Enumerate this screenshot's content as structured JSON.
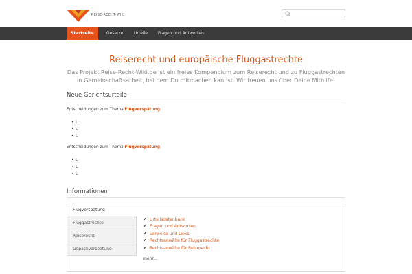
{
  "header": {
    "logo_text": "REISE-RECHT-WIKI",
    "brand_colors": [
      "#e5531c",
      "#c0392b",
      "#f0a020"
    ],
    "search": {
      "placeholder": "",
      "icon": "search-icon"
    }
  },
  "nav": {
    "items": [
      {
        "label": "Startseite",
        "active": true
      },
      {
        "label": "Gesetze",
        "active": false
      },
      {
        "label": "Urteile",
        "active": false
      },
      {
        "label": "Fragen und Antworten",
        "active": false
      }
    ]
  },
  "main": {
    "title": "Reiserecht und europäische Fluggastrechte",
    "intro": "Das Projekt Reise-Recht-Wiki.de ist ein freies Kompendium zum Reiserecht und zu Fluggastrechten in Gemeinschaftsarbeit, bei dem Du mitmachen kannst. Wir freuen uns über Deine Mithilfe!"
  },
  "rulings": {
    "heading": "Neue Gerichtsurteile",
    "blocks": [
      {
        "prefix": "Entscheidungen zum Thema",
        "topic": "Flugverspätung",
        "items": [
          "L",
          "L",
          "L"
        ]
      },
      {
        "prefix": "Entscheidungen zum Thema",
        "topic": "Flugverspätung",
        "items": [
          "L",
          "L",
          "L"
        ]
      }
    ]
  },
  "info": {
    "heading": "Informationen",
    "tabs": [
      {
        "label": "Flugverspätung",
        "active": true
      },
      {
        "label": "Fluggastrechte",
        "active": false
      },
      {
        "label": "Reiserecht",
        "active": false
      },
      {
        "label": "Gepäckverspätung",
        "active": false
      }
    ],
    "links": [
      "Urteilsdatenbank",
      "Fragen und Antworten",
      "Verweise und Links",
      "Rechtsanwälte für Fluggastrechte",
      "Rechtsanwälte für Reiserecht"
    ],
    "more": "mehr..."
  },
  "colors": {
    "accent": "#d9581e",
    "nav_bg": "#3b3b3b",
    "active_tab": "#e5531c"
  }
}
